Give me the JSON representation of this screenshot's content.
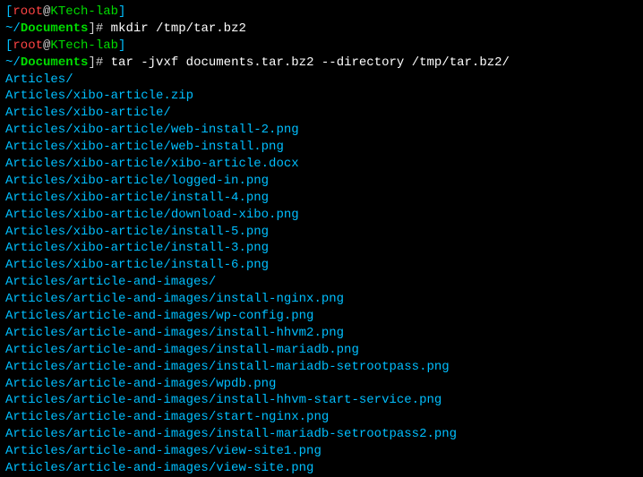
{
  "prompt1": {
    "open": "[",
    "user": "root",
    "at": "@",
    "host": "KTech-lab",
    "close": "]",
    "tilde": "~/",
    "path": "Documents",
    "end": "]#",
    "cmd": " mkdir /tmp/tar.bz2"
  },
  "prompt2": {
    "open": "[",
    "user": "root",
    "at": "@",
    "host": "KTech-lab",
    "close": "]",
    "tilde": "~/",
    "path": "Documents",
    "end": "]#",
    "cmd": " tar -jvxf documents.tar.bz2 --directory /tmp/tar.bz2/"
  },
  "output": [
    "Articles/",
    "Articles/xibo-article.zip",
    "Articles/xibo-article/",
    "Articles/xibo-article/web-install-2.png",
    "Articles/xibo-article/web-install.png",
    "Articles/xibo-article/xibo-article.docx",
    "Articles/xibo-article/logged-in.png",
    "Articles/xibo-article/install-4.png",
    "Articles/xibo-article/download-xibo.png",
    "Articles/xibo-article/install-5.png",
    "Articles/xibo-article/install-3.png",
    "Articles/xibo-article/install-6.png",
    "Articles/article-and-images/",
    "Articles/article-and-images/install-nginx.png",
    "Articles/article-and-images/wp-config.png",
    "Articles/article-and-images/install-hhvm2.png",
    "Articles/article-and-images/install-mariadb.png",
    "Articles/article-and-images/install-mariadb-setrootpass.png",
    "Articles/article-and-images/wpdb.png",
    "Articles/article-and-images/install-hhvm-start-service.png",
    "Articles/article-and-images/start-nginx.png",
    "Articles/article-and-images/install-mariadb-setrootpass2.png",
    "Articles/article-and-images/view-site1.png",
    "Articles/article-and-images/view-site.png"
  ]
}
